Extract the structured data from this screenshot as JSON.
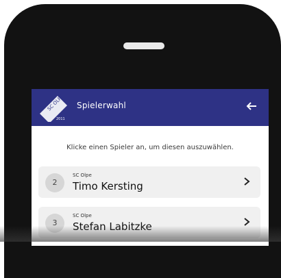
{
  "appbar": {
    "title": "Spielerwahl",
    "logo": {
      "icon": "club-crest-icon",
      "text": "SC OLPE",
      "year": "2011"
    },
    "back_icon": "arrow-left-icon",
    "color": "#2e3285"
  },
  "hint": "Klicke einen Spieler an, um diesen auszuwählen.",
  "players": [
    {
      "number": "2",
      "club": "SC Olpe",
      "name": "Timo Kersting"
    },
    {
      "number": "3",
      "club": "SC Olpe",
      "name": "Stefan Labitzke"
    }
  ],
  "chevron_icon": "chevron-right-icon"
}
